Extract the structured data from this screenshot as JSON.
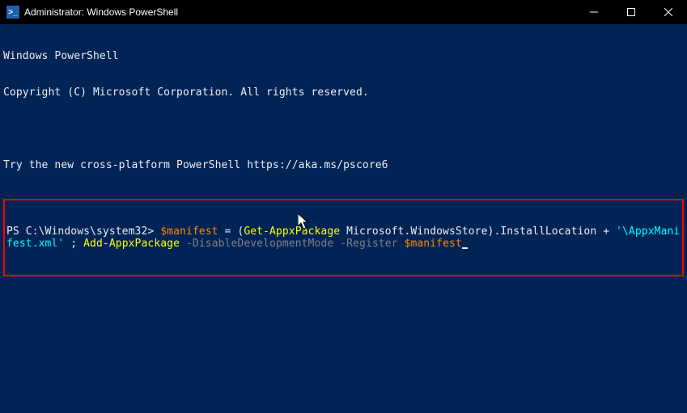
{
  "titlebar": {
    "icon_label": ">_",
    "title": "Administrator: Windows PowerShell"
  },
  "terminal": {
    "banner_line1": "Windows PowerShell",
    "banner_line2": "Copyright (C) Microsoft Corporation. All rights reserved.",
    "try_line": "Try the new cross-platform PowerShell https://aka.ms/pscore6",
    "prompt": "PS C:\\Windows\\system32> ",
    "cmd": {
      "var1": "$manifest",
      "eq": " = (",
      "cmdlet1": "Get-AppxPackage",
      "arg1": " Microsoft.WindowsStore).InstallLocation ",
      "plus": "+ ",
      "str1": "'\\AppxManifest.xml'",
      "sep": " ; ",
      "cmdlet2a": "Add-",
      "cmdlet2b": "AppxPackage",
      "space1": " ",
      "param1": "-DisableDevelopmentMode",
      "space2": " ",
      "param2": "-Register",
      "space3": " ",
      "var2": "$manifest"
    }
  }
}
